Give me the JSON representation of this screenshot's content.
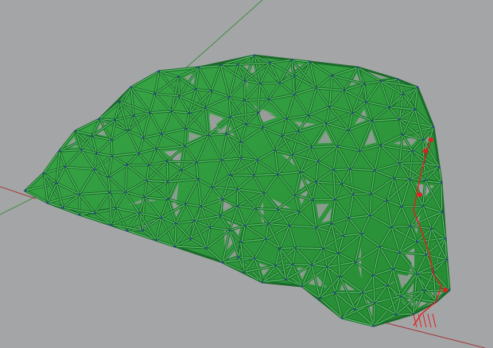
{
  "viewport": {
    "background_color": "#a4a5a7",
    "axis_colors": {
      "x": "#a33a3a",
      "y": "#3f8f3f"
    },
    "mesh": {
      "fill_color": "#2f9a3c",
      "fill_highlight": "#56c064",
      "edge_color": "#1a6a2a",
      "vertex_color": "#2a3fa0",
      "selected_color": "#e02020"
    }
  }
}
